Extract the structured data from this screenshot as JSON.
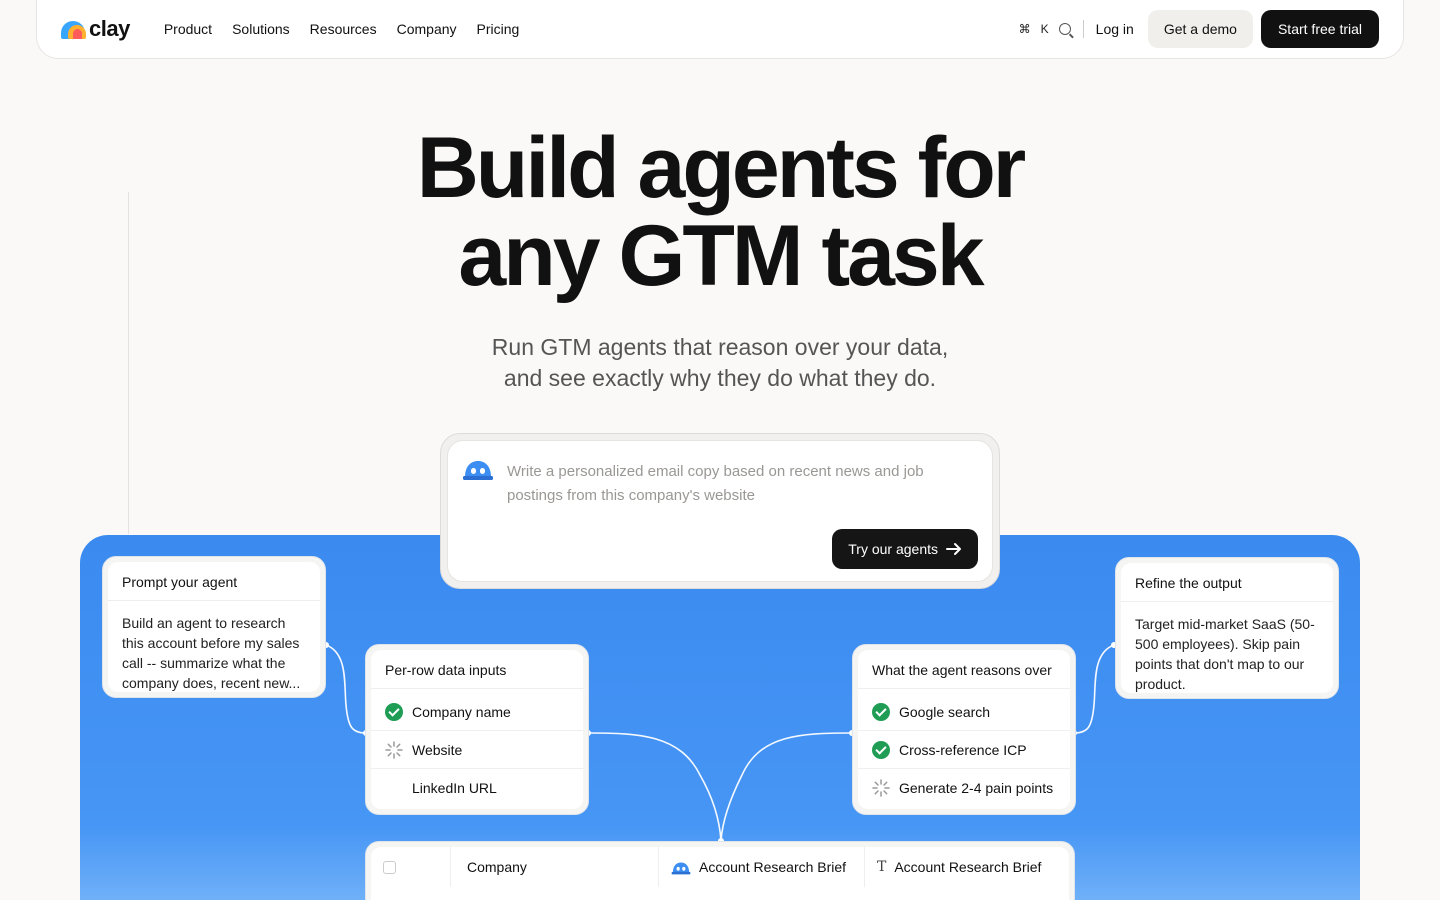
{
  "brand": {
    "name": "clay"
  },
  "nav": {
    "links": [
      "Product",
      "Solutions",
      "Resources",
      "Company",
      "Pricing"
    ],
    "shortcut_cmd": "⌘",
    "shortcut_key": "K",
    "login": "Log in",
    "demo": "Get a demo",
    "trial": "Start free trial"
  },
  "hero": {
    "line1": "Build agents for",
    "line2": "any GTM task",
    "sub1": "Run GTM agents that reason over your data,",
    "sub2": "and see exactly why they do what they do."
  },
  "prompt": {
    "text": "Write a personalized email copy based on recent news and job postings from this company's website",
    "button": "Try our agents"
  },
  "cards": {
    "prompt_agent": {
      "title": "Prompt your agent",
      "body": "Build an agent to research this account before my sales call -- summarize what the company does, recent new..."
    },
    "inputs": {
      "title": "Per-row data inputs",
      "items": [
        "Company name",
        "Website",
        "LinkedIn URL"
      ]
    },
    "reasons": {
      "title": "What the agent reasons over",
      "items": [
        "Google search",
        "Cross-reference ICP",
        "Generate 2-4 pain points"
      ]
    },
    "refine": {
      "title": "Refine the output",
      "body": "Target mid-market SaaS (50-500 employees). Skip pain points that don't map to our product."
    }
  },
  "table": {
    "col1": "Company",
    "col2": "Account Research Brief",
    "col3_icon": "T",
    "col3": "Account Research Brief"
  },
  "colors": {
    "panel_blue": "#3d8ef2",
    "check_green": "#1f9d55",
    "dark_button": "#151515"
  }
}
